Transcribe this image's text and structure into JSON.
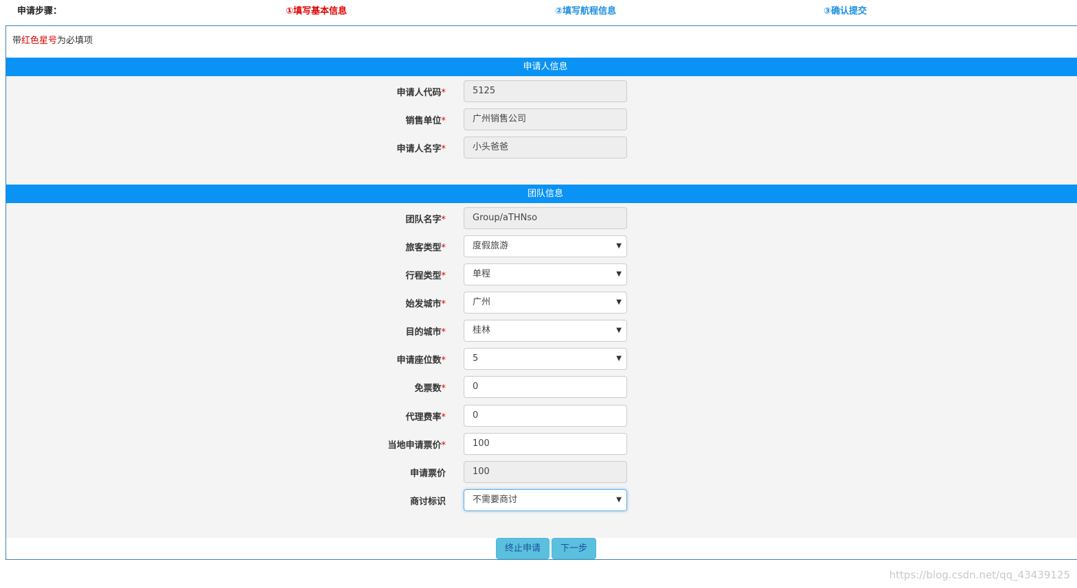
{
  "steps": {
    "label": "申请步骤：",
    "step1": "①填写基本信息",
    "step2": "②填写航程信息",
    "step3": "③确认提交",
    "active_color": "#e00000",
    "inactive_color": "#1c8fe0"
  },
  "note": {
    "prefix": "带",
    "highlight": "红色星号",
    "suffix": "为必填项"
  },
  "applicant_section": {
    "title": "申请人信息",
    "fields": [
      {
        "label": "申请人代码",
        "required": "*",
        "value": "5125"
      },
      {
        "label": "销售单位",
        "required": "*",
        "value": "广州销售公司"
      },
      {
        "label": "申请人名字",
        "required": "*",
        "value": "小头爸爸"
      }
    ]
  },
  "team_section": {
    "title": "团队信息",
    "fields": [
      {
        "label": "团队名字",
        "required": "*",
        "value": "Group/aTHNso"
      },
      {
        "label": "旅客类型",
        "required": "*",
        "value": "度假旅游"
      },
      {
        "label": "行程类型",
        "required": "*",
        "value": "单程"
      },
      {
        "label": "始发城市",
        "required": "*",
        "value": "广州"
      },
      {
        "label": "目的城市",
        "required": "*",
        "value": "桂林"
      },
      {
        "label": "申请座位数",
        "required": "*",
        "value": "5"
      },
      {
        "label": "免票数",
        "required": "*",
        "value": "0"
      },
      {
        "label": "代理费率",
        "required": "*",
        "value": "0"
      },
      {
        "label": "当地申请票价",
        "required": "*",
        "value": "100"
      },
      {
        "label": "申请票价",
        "required": "",
        "value": "100"
      },
      {
        "label": "商讨标识",
        "required": "",
        "value": "不需要商讨"
      }
    ]
  },
  "buttons": {
    "stop": "终止申请",
    "next": "下一步"
  },
  "watermark": "https://blog.csdn.net/qq_43439125",
  "icons": {
    "dropdown": "chevron-down-icon"
  },
  "colors": {
    "section_bar": "#0a93f5",
    "button": "#5bc0de",
    "required": "#e00000"
  }
}
